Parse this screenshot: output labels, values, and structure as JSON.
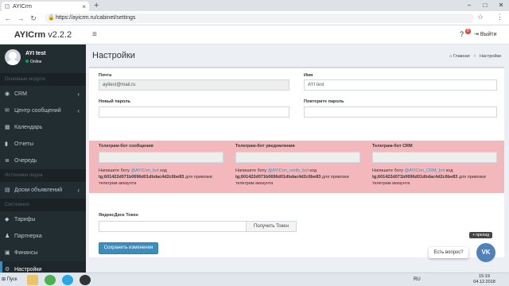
{
  "browser": {
    "tab_title": "AYICrm",
    "new_tab": "+",
    "url": "https://ayicrm.ru/cabinet/settings",
    "win_min": "–",
    "win_max": "□",
    "win_close": "✕"
  },
  "header": {
    "logo_brand": "AYICrm",
    "logo_version": " v2.2.2",
    "help_badge": "8",
    "logout_label": "Выйти"
  },
  "sidebar": {
    "user_name": "AYI test",
    "user_status": "Online",
    "sections": [
      {
        "title": "Основные модули",
        "items": [
          {
            "label": "CRM",
            "icon": "dashboard-icon",
            "chevron": true
          },
          {
            "label": "Центр сообщений",
            "icon": "envelope-icon",
            "chevron": true
          },
          {
            "label": "Календарь",
            "icon": "calendar-icon",
            "chevron": false
          },
          {
            "label": "Отчеты",
            "icon": "chart-icon",
            "chevron": false
          },
          {
            "label": "Очередь",
            "icon": "queue-icon",
            "chevron": false
          }
        ]
      },
      {
        "title": "Источники лидов",
        "items": [
          {
            "label": "Доски объявлений",
            "icon": "board-icon",
            "chevron": true
          }
        ]
      },
      {
        "title": "Системное",
        "items": [
          {
            "label": "Тарифы",
            "icon": "tag-icon",
            "chevron": false
          },
          {
            "label": "Партнерка",
            "icon": "partners-icon",
            "chevron": false
          },
          {
            "label": "Финансы",
            "icon": "money-icon",
            "chevron": false
          },
          {
            "label": "Настройки",
            "icon": "gear-icon",
            "chevron": false,
            "active": true
          }
        ]
      }
    ]
  },
  "page": {
    "title": "Настройки",
    "breadcrumb_home": "Главная",
    "breadcrumb_current": "Настройки"
  },
  "form": {
    "email_label": "Почта",
    "email_value": "ayitest@mail.ru",
    "name_label": "Имя",
    "name_value": "AYI test",
    "new_password_label": "Новый пароль",
    "repeat_password_label": "Повторите пароль",
    "tg_msg_label": "Телеграм-бот сообщения",
    "tg_notify_label": "Телеграм-бот уведомления",
    "tg_crm_label": "Телеграм-бот CRM",
    "hint_prefix": "Напишите боту ",
    "hint_code_word": " код",
    "hint_suffix": " для привязки телеграм аккаунта",
    "bot_msg": "@AYICrm_bot",
    "bot_notify": "@AYICrm_notify_bot",
    "bot_crm": "@AYICrm_CRM_bot",
    "token_code": "tg;601422d071b0696d01dbdac4d2c6be83",
    "yandex_label": "ЯндексДиск Токен",
    "get_token_button": "Получить Токен",
    "save_button": "Сохранить изменения"
  },
  "chat": {
    "question_label": "Есть вопрос?",
    "plus_label": "+ прелид",
    "vk_label": "VK"
  },
  "taskbar": {
    "start_label": "Пуск",
    "tray_lang": "RU",
    "time": "15:19",
    "date": "04.12.2018"
  },
  "colors": {
    "sidebar_bg": "#222d32",
    "accent": "#3c8dbc",
    "telegram_band": "#f2b8bb",
    "vk": "#5181b8"
  }
}
